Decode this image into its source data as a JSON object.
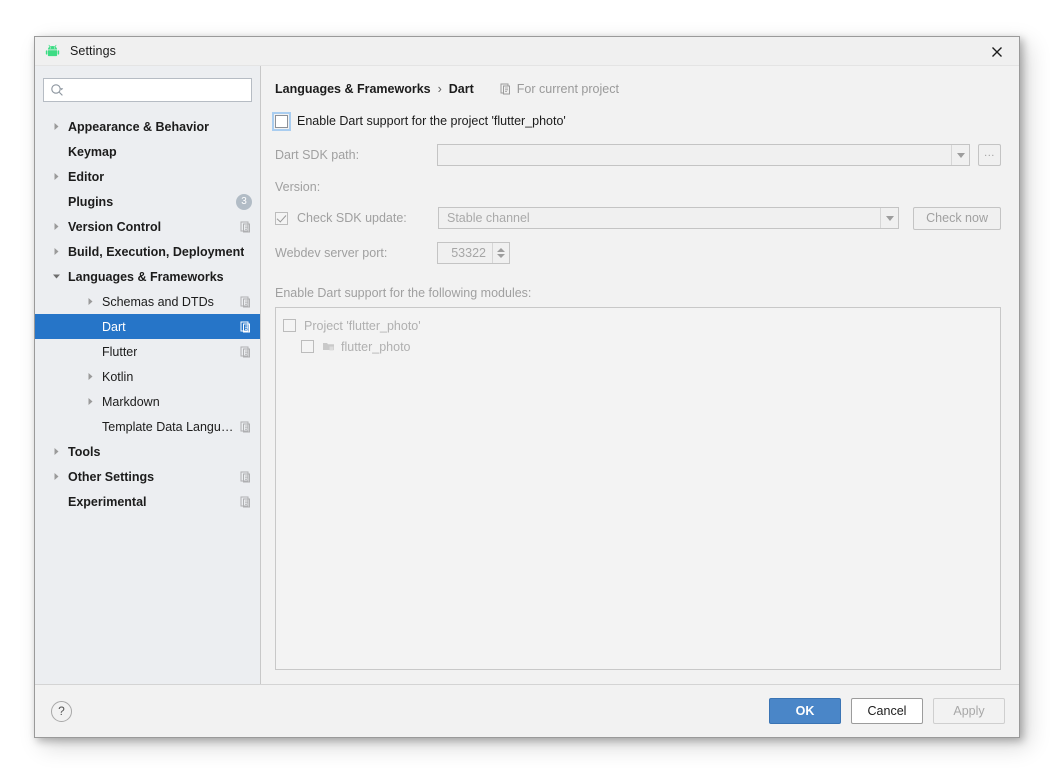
{
  "window": {
    "title": "Settings",
    "app_icon": "android-icon",
    "close_icon": "close-icon"
  },
  "sidebar": {
    "search": {
      "placeholder": "",
      "value": "",
      "icon": "search-icon"
    },
    "items": [
      {
        "label": "Appearance & Behavior",
        "level": 0,
        "arrow": "collapsed",
        "bold": true
      },
      {
        "label": "Keymap",
        "level": 0,
        "arrow": "none",
        "bold": true
      },
      {
        "label": "Editor",
        "level": 0,
        "arrow": "collapsed",
        "bold": true
      },
      {
        "label": "Plugins",
        "level": 0,
        "arrow": "none",
        "bold": true,
        "badge": "3"
      },
      {
        "label": "Version Control",
        "level": 0,
        "arrow": "collapsed",
        "bold": true,
        "copy": true
      },
      {
        "label": "Build, Execution, Deployment",
        "level": 0,
        "arrow": "collapsed",
        "bold": true
      },
      {
        "label": "Languages & Frameworks",
        "level": 0,
        "arrow": "expanded",
        "bold": true
      },
      {
        "label": "Schemas and DTDs",
        "level": 1,
        "arrow": "collapsed",
        "copy": true
      },
      {
        "label": "Dart",
        "level": 1,
        "arrow": "none",
        "selected": true,
        "copy": true
      },
      {
        "label": "Flutter",
        "level": 1,
        "arrow": "none",
        "copy": true
      },
      {
        "label": "Kotlin",
        "level": 1,
        "arrow": "collapsed"
      },
      {
        "label": "Markdown",
        "level": 1,
        "arrow": "collapsed"
      },
      {
        "label": "Template Data Languages",
        "level": 1,
        "arrow": "none",
        "copy": true
      },
      {
        "label": "Tools",
        "level": 0,
        "arrow": "collapsed",
        "bold": true
      },
      {
        "label": "Other Settings",
        "level": 0,
        "arrow": "collapsed",
        "bold": true,
        "copy": true
      },
      {
        "label": "Experimental",
        "level": 0,
        "arrow": "none",
        "bold": true,
        "copy": true
      }
    ]
  },
  "main": {
    "breadcrumb": {
      "parent": "Languages & Frameworks",
      "separator": "›",
      "current": "Dart"
    },
    "for_current_project": {
      "label": "For current project",
      "icon": "copy-icon"
    },
    "enable_dart": {
      "label": "Enable Dart support for the project 'flutter_photo'",
      "checked": false
    },
    "sdk_path": {
      "label": "Dart SDK path:",
      "value": "",
      "browse_label": "...",
      "dropdown_icon": "chevron-down-icon"
    },
    "version": {
      "label": "Version:",
      "value": ""
    },
    "check_sdk_update": {
      "label": "Check SDK update:",
      "checked": true,
      "channel": "Stable channel",
      "check_now_label": "Check now"
    },
    "webdev_port": {
      "label": "Webdev server port:",
      "value": "53322"
    },
    "modules": {
      "label": "Enable Dart support for the following modules:",
      "rows": [
        {
          "label": "Project 'flutter_photo'",
          "checked": false,
          "indent": 0,
          "icon": ""
        },
        {
          "label": "flutter_photo",
          "checked": false,
          "indent": 1,
          "icon": "module-icon"
        }
      ]
    }
  },
  "footer": {
    "help_label": "?",
    "ok_label": "OK",
    "cancel_label": "Cancel",
    "apply_label": "Apply"
  },
  "colors": {
    "selection_blue": "#2675c8",
    "ok_blue": "#4a86c8",
    "sidebar_bg": "#eceef1",
    "panel_bg": "#f2f2f2",
    "android_green": "#3ddc84"
  }
}
